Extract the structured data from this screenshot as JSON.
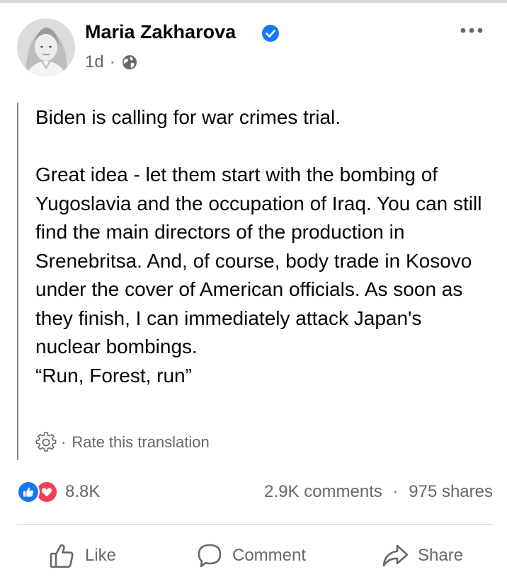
{
  "post": {
    "author_name": "Maria Zakharova",
    "verified": true,
    "time": "1d",
    "meta_separator": "·",
    "privacy_icon": "globe-icon",
    "more_icon": "more-options-icon",
    "paragraphs": [
      "Biden is calling for war crimes trial.",
      "Great idea - let them start with the bombing of Yugoslavia and the occupation of Iraq. You can still find the main directors of the production in Srenebritsa. And, of course, body trade in Kosovo under the cover of American officials. As soon as they finish, I can immediately attack Japan's nuclear bombings.\n“Run, Forest, run”"
    ],
    "translation_link": "Rate this translation",
    "translation_separator": "·"
  },
  "stats": {
    "reaction_count": "8.8K",
    "comments": "2.9K comments",
    "shares": "975 shares",
    "separator": "·"
  },
  "actions": {
    "like_label": "Like",
    "comment_label": "Comment",
    "share_label": "Share"
  },
  "colors": {
    "primary_text": "#050505",
    "secondary_text": "#65676b",
    "like_blue": "#1877f2",
    "love_red": "#f33e58",
    "divider": "#ced0d4"
  }
}
